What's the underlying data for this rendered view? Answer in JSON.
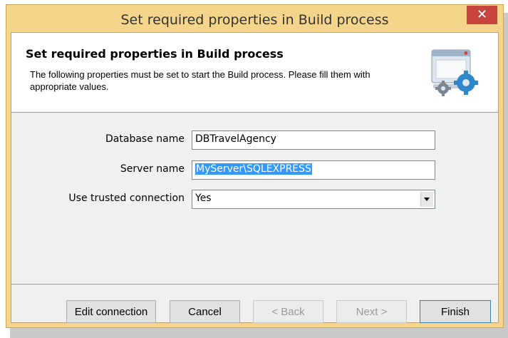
{
  "window": {
    "title": "Set required properties in Build process",
    "close_glyph": "✕"
  },
  "header": {
    "title": "Set required properties in Build process",
    "description": "The following properties must be set to start the Build process. Please fill them with appropriate values.",
    "icon": "window-gear-icon"
  },
  "form": {
    "database_label": "Database name",
    "database_value": "DBTravelAgency",
    "server_label": "Server name",
    "server_value": "MyServer\\SQLEXPRESS",
    "trusted_label": "Use trusted connection",
    "trusted_value": "Yes"
  },
  "buttons": {
    "edit_connection": "Edit connection",
    "cancel": "Cancel",
    "back": "< Back",
    "next": "Next >",
    "finish": "Finish"
  }
}
